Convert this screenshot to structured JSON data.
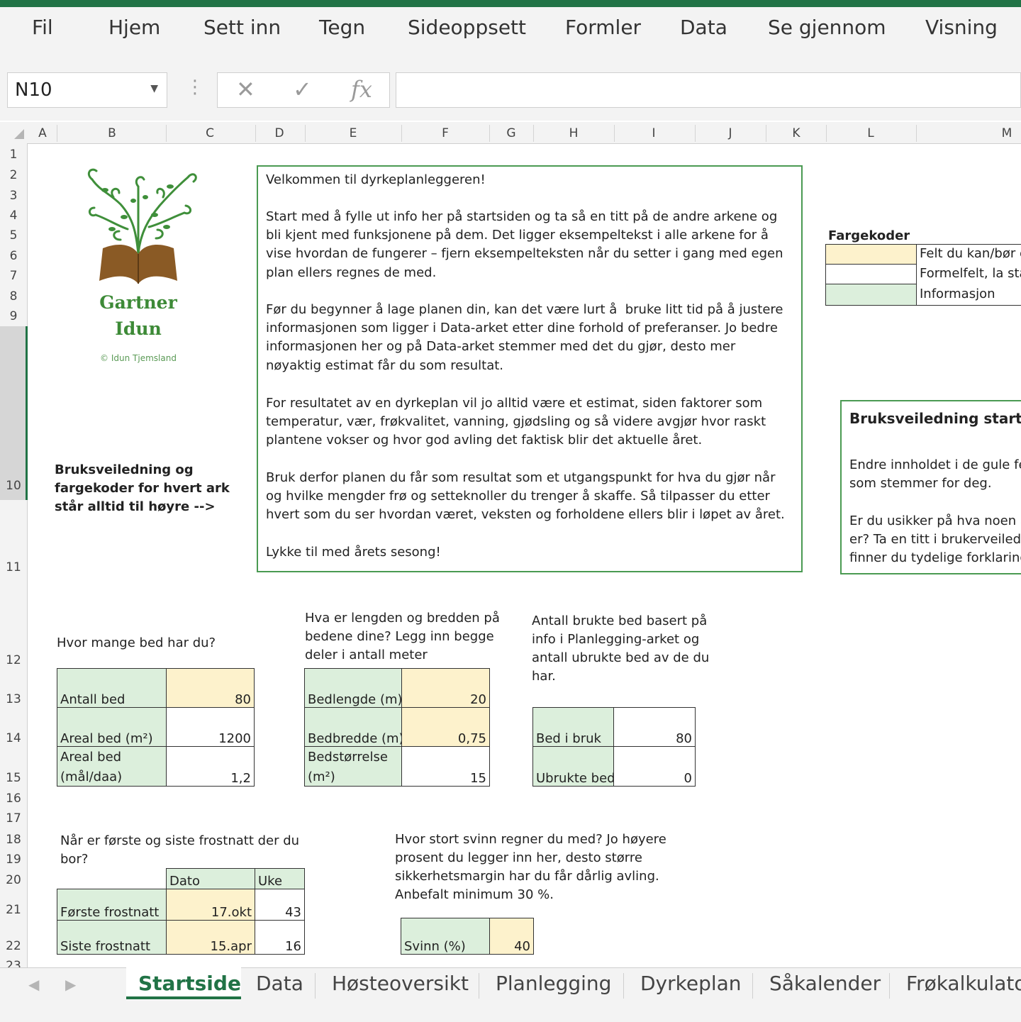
{
  "ribbon": {
    "tabs": [
      "Fil",
      "Hjem",
      "Sett inn",
      "Tegn",
      "Sideoppsett",
      "Formler",
      "Data",
      "Se gjennom",
      "Visning"
    ]
  },
  "formula_bar": {
    "name_box": "N10",
    "cancel_symbol": "✕",
    "enter_symbol": "✓",
    "fx_label": "fx",
    "formula": ""
  },
  "columns": [
    "A",
    "B",
    "C",
    "D",
    "E",
    "F",
    "G",
    "H",
    "I",
    "J",
    "K",
    "L",
    "M"
  ],
  "rows": [
    "1",
    "2",
    "3",
    "4",
    "5",
    "6",
    "7",
    "8",
    "9",
    "10",
    "11",
    "12",
    "13",
    "14",
    "15",
    "16",
    "17",
    "18",
    "19",
    "20",
    "21",
    "22",
    "23"
  ],
  "logo": {
    "name_line1": "Gartner",
    "name_line2": "Idun",
    "copyright": "© Idun Tjemsland"
  },
  "guide_note": "Bruksveiledning og fargekoder for hvert ark står alltid til høyre  -->",
  "welcome": {
    "p1": "Velkommen til dyrkeplanleggeren!",
    "p2": "Start med å fylle ut info her på startsiden og ta så en titt på de andre arkene og bli kjent med funksjonene på dem. Det ligger eksempeltekst i alle arkene for å vise hvordan de fungerer – fjern eksempelteksten når du setter i gang med egen plan ellers regnes de med.",
    "p3": "Før du begynner å lage planen din, kan det være lurt å  bruke litt tid på å justere informasjonen som ligger i Data-arket etter dine forhold of preferanser. Jo bedre informasjonen her og på Data-arket stemmer med det du gjør, desto mer nøyaktig estimat får du som resultat.",
    "p4": "For resultatet av en dyrkeplan vil jo alltid være et estimat, siden faktorer som temperatur, vær, frøkvalitet, vanning, gjødsling og så videre avgjør hvor raskt plantene vokser og hvor god avling det faktisk blir det aktuelle året.",
    "p5": "Bruk derfor planen du får som resultat som et utgangspunkt for hva du gjør når og hvilke mengder frø og setteknoller du trenger å skaffe. Så tilpasser du etter hvert som du ser hvordan været, veksten og forholdene ellers blir i løpet av året.",
    "p6": "Lykke til med årets sesong!"
  },
  "color_codes": {
    "title": "Fargekoder",
    "items": [
      {
        "label": "Felt du kan/bør e",
        "color": "#fdf2cc"
      },
      {
        "label": "Formelfelt, la stå",
        "color": "#ffffff"
      },
      {
        "label": "Informasjon",
        "color": "#dcefdc"
      }
    ]
  },
  "guide_box": {
    "title": "Bruksveiledning startsid",
    "p1_l1": "Endre innholdet i de gule fe",
    "p1_l2": "som stemmer for deg.",
    "p2_l1": "Er du usikker på hva noen a",
    "p2_l2": "er? Ta en titt i brukerveiledn",
    "p2_l3": "finner du tydelige forklaring"
  },
  "beds": {
    "question": "Hvor mange bed har du?",
    "rows": [
      {
        "label": "Antall bed",
        "value": "80"
      },
      {
        "label": "Areal bed (m²)",
        "value": "1200"
      },
      {
        "label_l1": "Areal bed",
        "label_l2": "(mål/daa)",
        "value": "1,2"
      }
    ]
  },
  "bed_size": {
    "question_l1": "Hva er lengden og bredden på",
    "question_l2": "bedene dine? Legg inn begge",
    "question_l3": "deler i antall meter",
    "rows": [
      {
        "label": "Bedlengde (m)",
        "value": "20"
      },
      {
        "label": "Bedbredde (m)",
        "value": "0,75"
      },
      {
        "label_l1": "Bedstørrelse",
        "label_l2": "(m²)",
        "value": "15"
      }
    ]
  },
  "used_beds": {
    "question_l1": "Antall brukte bed basert på",
    "question_l2": "info i Planlegging-arket og",
    "question_l3": "antall ubrukte bed av de du",
    "question_l4": "har.",
    "rows": [
      {
        "label": "Bed i bruk",
        "value": "80"
      },
      {
        "label": "Ubrukte bed",
        "value": "0"
      }
    ]
  },
  "frost": {
    "question_l1": "Når er første og siste frostnatt der du",
    "question_l2": "bor?",
    "col_date": "Dato",
    "col_week": "Uke",
    "rows": [
      {
        "label": "Første frostnatt",
        "date": "17.okt",
        "week": "43"
      },
      {
        "label": "Siste frostnatt",
        "date": "15.apr",
        "week": "16"
      }
    ]
  },
  "waste": {
    "q_l1": "Hvor stort svinn regner du med? Jo høyere",
    "q_l2": "prosent du legger inn her, desto større",
    "q_l3": "sikkerhetsmargin har du får dårlig avling.",
    "q_l4": "Anbefalt minimum 30 %.",
    "label": "Svinn (%)",
    "value": "40"
  },
  "sheet_tabs": {
    "active": "Startside",
    "tabs": [
      "Startside",
      "Data",
      "Høsteoversikt",
      "Planlegging",
      "Dyrkeplan",
      "Såkalender",
      "Frøkalkulato"
    ]
  }
}
